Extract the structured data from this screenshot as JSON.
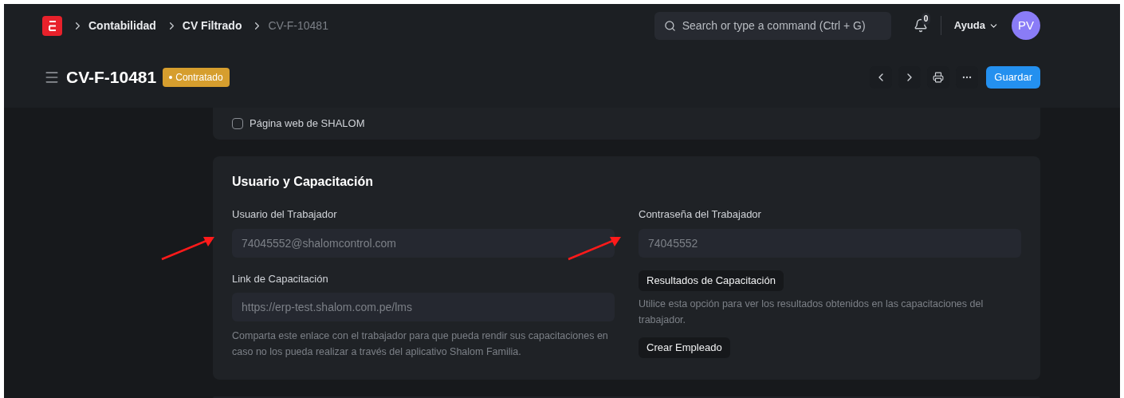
{
  "navbar": {
    "breadcrumbs": [
      {
        "label": "Contabilidad",
        "current": false
      },
      {
        "label": "CV Filtrado",
        "current": false
      },
      {
        "label": "CV-F-10481",
        "current": true
      }
    ],
    "search": {
      "placeholder": "Search or type a command (Ctrl + G)"
    },
    "notification_count": "0",
    "help_menu": "Ayuda",
    "avatar": "PV"
  },
  "page_header": {
    "title": "CV-F-10481",
    "status": "Contratado",
    "primary_button": "Guardar"
  },
  "previous_section": {
    "checkbox": {
      "label": "Página web de SHALOM",
      "checked": false
    }
  },
  "section": {
    "title": "Usuario y Capacitación",
    "left": [
      {
        "label": "Usuario del Trabajador",
        "value": "74045552@shalomcontrol.com",
        "annotated": true
      },
      {
        "label": "Link de Capacitación",
        "value": "https://erp-test.shalom.com.pe/lms",
        "annotated": false,
        "description": "Comparta este enlace con el trabajador para que pueda rendir sus capacitaciones en caso no los pueda realizar a través del aplicativo Shalom Familia."
      }
    ],
    "right_field": {
      "label": "Contraseña del Trabajador",
      "value": "74045552",
      "annotated": true
    },
    "actions": [
      {
        "label": "Resultados de Capacitación",
        "description": "Utilice esta opción para ver los resultados obtenidos en las capacitaciones del trabajador."
      },
      {
        "label": "Crear Empleado"
      }
    ]
  }
}
